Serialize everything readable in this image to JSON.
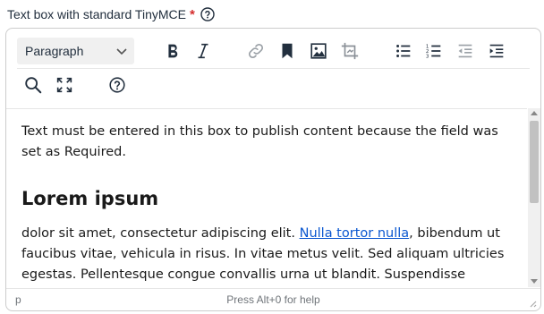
{
  "field": {
    "label": "Text box with standard TinyMCE",
    "required_marker": "*",
    "help_icon": "help-circle-icon"
  },
  "toolbar": {
    "block_format": "Paragraph",
    "buttons_row1": [
      "bold",
      "italic",
      "link",
      "bookmark",
      "image",
      "crop-image",
      "bullet-list",
      "numbered-list",
      "outdent",
      "indent"
    ],
    "buttons_row2": [
      "search",
      "fullscreen",
      "help"
    ]
  },
  "content": {
    "intro": "Text must be entered in this box to publish content because the field was set as Required.",
    "heading": "Lorem ipsum",
    "para_start": "dolor sit amet, consectetur adipiscing elit. ",
    "link_text": "Nulla tortor nulla",
    "para_end": ", bibendum ut faucibus vitae, vehicula in risus. In vitae metus velit. Sed aliquam ultricies egestas. Pellentesque congue convallis urna ut blandit. Suspendisse lobortis"
  },
  "statusbar": {
    "path": "p",
    "hint": "Press Alt+0 for help"
  },
  "colors": {
    "text": "#222f3e",
    "required": "#d42d2d",
    "link": "#0b57d0",
    "border": "#cccccc"
  }
}
